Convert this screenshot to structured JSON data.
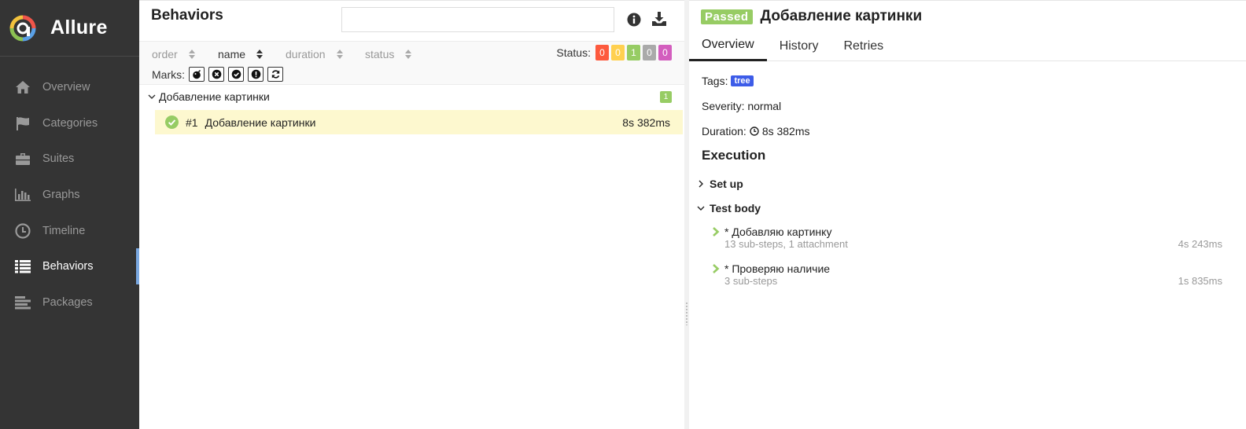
{
  "sidebar": {
    "brand": "Allure",
    "items": [
      {
        "label": "Overview",
        "icon": "home-icon"
      },
      {
        "label": "Categories",
        "icon": "flag-icon"
      },
      {
        "label": "Suites",
        "icon": "briefcase-icon"
      },
      {
        "label": "Graphs",
        "icon": "bar-chart-icon"
      },
      {
        "label": "Timeline",
        "icon": "clock-icon"
      },
      {
        "label": "Behaviors",
        "icon": "list-icon",
        "active": true
      },
      {
        "label": "Packages",
        "icon": "align-left-icon"
      }
    ]
  },
  "behaviors": {
    "title": "Behaviors",
    "search": {
      "value": "",
      "placeholder": ""
    },
    "sorters": [
      "order",
      "name",
      "duration",
      "status"
    ],
    "active_sorter": "name",
    "status_label": "Status:",
    "status_counts": [
      {
        "value": "0",
        "color": "#fd5a3e"
      },
      {
        "value": "0",
        "color": "#ffd050"
      },
      {
        "value": "1",
        "color": "#97cc64"
      },
      {
        "value": "0",
        "color": "#aaaaaa"
      },
      {
        "value": "0",
        "color": "#d35ebe"
      }
    ],
    "marks_label": "Marks:",
    "marks": [
      "bomb-icon",
      "times-circle-icon",
      "check-circle-icon",
      "exclamation-circle-icon",
      "refresh-icon"
    ],
    "group": {
      "name": "Добавление картинки",
      "count": "1"
    },
    "test": {
      "number": "#1",
      "name": "Добавление картинки",
      "duration": "8s 382ms",
      "status": "passed"
    }
  },
  "detail": {
    "status_badge": "Passed",
    "title": "Добавление картинки",
    "tabs": [
      "Overview",
      "History",
      "Retries"
    ],
    "tags_label": "Tags:",
    "tag": "tree",
    "severity": "Severity: normal",
    "duration_label": "Duration:",
    "duration": "8s 382ms",
    "execution_title": "Execution",
    "setup_label": "Set up",
    "body_label": "Test body",
    "steps": [
      {
        "name": "* Добавляю картинку",
        "sub": "13 sub-steps, 1 attachment",
        "duration": "4s 243ms"
      },
      {
        "name": "* Проверяю наличие",
        "sub": "3 sub-steps",
        "duration": "1s 835ms"
      }
    ]
  },
  "colors": {
    "sidebar_bg": "#343434",
    "active_accent": "#7aa8e0",
    "passed": "#97cc64",
    "tag": "#3d5ce8",
    "selected_row": "#fdf8cf"
  }
}
